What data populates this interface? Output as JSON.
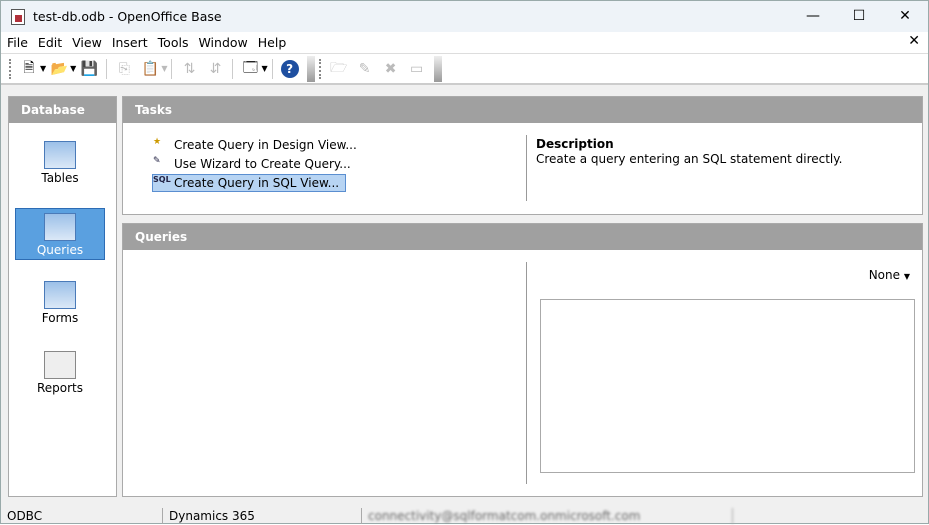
{
  "window": {
    "title": "test-db.odb - OpenOffice Base",
    "minimize": "—",
    "maximize": "☐",
    "close": "✕",
    "doc_close": "✕"
  },
  "menu": [
    "File",
    "Edit",
    "View",
    "Insert",
    "Tools",
    "Window",
    "Help"
  ],
  "toolbar": {
    "icons": [
      "new-document-icon",
      "open-folder-icon",
      "save-icon",
      "copy-icon",
      "paste-icon",
      "sort-ascending-icon",
      "sort-descending-icon",
      "new-form-icon",
      "help-icon",
      "open-object-icon",
      "edit-object-icon",
      "delete-object-icon",
      "rename-object-icon"
    ]
  },
  "sidebar": {
    "header": "Database",
    "items": [
      {
        "label": "Tables"
      },
      {
        "label": "Queries",
        "selected": true
      },
      {
        "label": "Forms"
      },
      {
        "label": "Reports"
      }
    ]
  },
  "tasks": {
    "header": "Tasks",
    "items": [
      {
        "label": "Create Query in Design View...",
        "icon": "★"
      },
      {
        "label": "Use Wizard to Create Query...",
        "icon": "✎"
      },
      {
        "label": "Create Query in SQL View...",
        "icon": "SQL",
        "selected": true
      }
    ],
    "description_title": "Description",
    "description": "Create a query  entering an SQL statement directly."
  },
  "queries": {
    "header": "Queries",
    "preview_select": "None"
  },
  "status": {
    "driver": "ODBC",
    "name": "Dynamics 365",
    "user": "connectivity@sqlformatcom.onmicrosoft.com"
  }
}
